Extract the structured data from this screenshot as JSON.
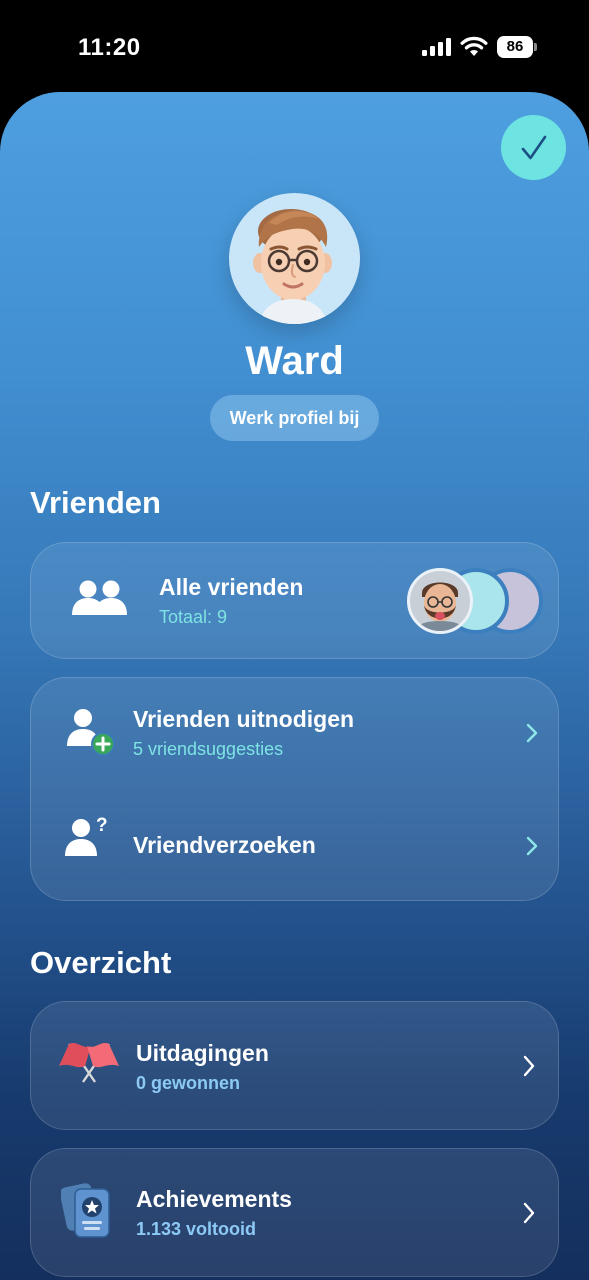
{
  "status_bar": {
    "time": "11:20",
    "battery": "86"
  },
  "profile": {
    "name": "Ward",
    "edit_label": "Werk profiel bij",
    "avatar_icon": "memoji-avatar-icon"
  },
  "friends": {
    "section_title": "Vrienden",
    "all_friends": {
      "title": "Alle vrienden",
      "subtitle": "Totaal: 9"
    },
    "invite": {
      "title": "Vrienden uitnodigen",
      "subtitle": "5 vriendsuggesties"
    },
    "requests": {
      "title": "Vriendverzoeken"
    }
  },
  "overview": {
    "section_title": "Overzicht",
    "challenges": {
      "title": "Uitdagingen",
      "subtitle": "0 gewonnen",
      "icon": "crossed-flags-icon"
    },
    "achievements": {
      "title": "Achievements",
      "subtitle": "1.133 voltooid",
      "icon": "achievement-cards-icon"
    }
  },
  "colors": {
    "accent_cyan": "#6de3e2",
    "subtitle_cyan": "#7de3e3",
    "subtitle_blue": "#8ccaf5"
  }
}
